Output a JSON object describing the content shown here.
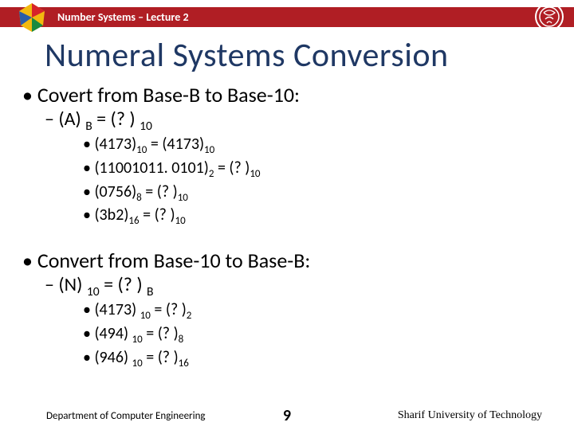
{
  "header": {
    "lecture": "Number Systems – Lecture 2"
  },
  "title": "Numeral Systems Conversion",
  "section1": {
    "heading": "Covert from Base-B to Base-10:",
    "formula_pre": "(A) ",
    "formula_sub1": "B",
    "formula_mid": "  =   (? ) ",
    "formula_sub2": "10",
    "ex1_pre": "(4173)",
    "ex1_sub1": "10",
    "ex1_mid": " = (4173)",
    "ex1_sub2": "10",
    "ex2_pre": "(11001011. 0101)",
    "ex2_sub1": "2",
    "ex2_mid": " = (? )",
    "ex2_sub2": "10",
    "ex3_pre": "(0756)",
    "ex3_sub1": "8",
    "ex3_mid": " = (? )",
    "ex3_sub2": "10",
    "ex4_pre": "(3b2)",
    "ex4_sub1": "16",
    "ex4_mid": " = (? )",
    "ex4_sub2": "10"
  },
  "section2": {
    "heading": "Convert from Base-10 to Base-B:",
    "formula_pre": "(N) ",
    "formula_sub1": "10",
    "formula_mid": "  =   (? ) ",
    "formula_sub2": "B",
    "ex1_pre": "(4173) ",
    "ex1_sub1": "10",
    "ex1_mid": "  =  (? )",
    "ex1_sub2": "2",
    "ex2_pre": "(494) ",
    "ex2_sub1": "10",
    "ex2_mid": "  =  (? )",
    "ex2_sub2": "8",
    "ex3_pre": "(946) ",
    "ex3_sub1": "10",
    "ex3_mid": "  =  (? )",
    "ex3_sub2": "16"
  },
  "footer": {
    "left": "Department of Computer Engineering",
    "page": "9",
    "right": "Sharif University of Technology"
  }
}
